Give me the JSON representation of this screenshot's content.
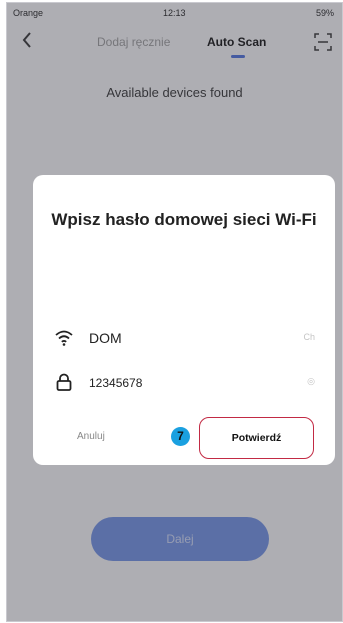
{
  "status_bar": {
    "carrier": "Orange",
    "time": "12:13",
    "battery": "59%"
  },
  "nav": {
    "back_icon": "chevron-left-icon",
    "tab_manual": "Dodaj ręcznie",
    "tab_auto": "Auto Scan",
    "scan_icon": "scan-frame-icon"
  },
  "subtitle": "Available devices found",
  "dialog": {
    "title": "Wpisz hasło domowej sieci Wi-Fi",
    "wifi_name": "DOM",
    "wifi_icon": "wifi-icon",
    "wifi_aux": "Ch",
    "password": "12345678",
    "password_icon": "lock-icon",
    "password_aux": "◎",
    "cancel_label": "Anuluj",
    "confirm_label": "Potwierdź",
    "step_badge": "7",
    "colors": {
      "badge": "#1aa0e0",
      "highlight_border": "#c22a44"
    }
  },
  "next_button": {
    "label": "Dalej",
    "color": "#6f8fe0"
  }
}
